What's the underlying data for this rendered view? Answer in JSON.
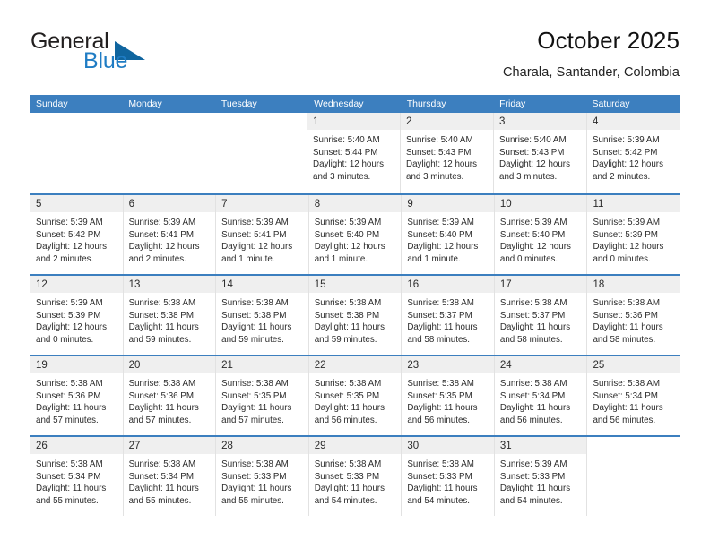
{
  "brand": {
    "name_part1": "General",
    "name_part2": "Blue",
    "color_dark": "#221f1f",
    "color_blue": "#1f7cc4",
    "triangle_color": "#10659f"
  },
  "header": {
    "title": "October 2025",
    "subtitle": "Charala, Santander, Colombia"
  },
  "theme": {
    "header_bar": "#3c7fbf",
    "day_band": "#efefef",
    "cell_divider": "#e2e2e2",
    "text": "#2b2b2b"
  },
  "weekdays": [
    "Sunday",
    "Monday",
    "Tuesday",
    "Wednesday",
    "Thursday",
    "Friday",
    "Saturday"
  ],
  "weeks": [
    [
      {
        "blank": true
      },
      {
        "blank": true
      },
      {
        "blank": true
      },
      {
        "day": "1",
        "lines": [
          "Sunrise: 5:40 AM",
          "Sunset: 5:44 PM",
          "Daylight: 12 hours",
          "and 3 minutes."
        ]
      },
      {
        "day": "2",
        "lines": [
          "Sunrise: 5:40 AM",
          "Sunset: 5:43 PM",
          "Daylight: 12 hours",
          "and 3 minutes."
        ]
      },
      {
        "day": "3",
        "lines": [
          "Sunrise: 5:40 AM",
          "Sunset: 5:43 PM",
          "Daylight: 12 hours",
          "and 3 minutes."
        ]
      },
      {
        "day": "4",
        "lines": [
          "Sunrise: 5:39 AM",
          "Sunset: 5:42 PM",
          "Daylight: 12 hours",
          "and 2 minutes."
        ]
      }
    ],
    [
      {
        "day": "5",
        "lines": [
          "Sunrise: 5:39 AM",
          "Sunset: 5:42 PM",
          "Daylight: 12 hours",
          "and 2 minutes."
        ]
      },
      {
        "day": "6",
        "lines": [
          "Sunrise: 5:39 AM",
          "Sunset: 5:41 PM",
          "Daylight: 12 hours",
          "and 2 minutes."
        ]
      },
      {
        "day": "7",
        "lines": [
          "Sunrise: 5:39 AM",
          "Sunset: 5:41 PM",
          "Daylight: 12 hours",
          "and 1 minute."
        ]
      },
      {
        "day": "8",
        "lines": [
          "Sunrise: 5:39 AM",
          "Sunset: 5:40 PM",
          "Daylight: 12 hours",
          "and 1 minute."
        ]
      },
      {
        "day": "9",
        "lines": [
          "Sunrise: 5:39 AM",
          "Sunset: 5:40 PM",
          "Daylight: 12 hours",
          "and 1 minute."
        ]
      },
      {
        "day": "10",
        "lines": [
          "Sunrise: 5:39 AM",
          "Sunset: 5:40 PM",
          "Daylight: 12 hours",
          "and 0 minutes."
        ]
      },
      {
        "day": "11",
        "lines": [
          "Sunrise: 5:39 AM",
          "Sunset: 5:39 PM",
          "Daylight: 12 hours",
          "and 0 minutes."
        ]
      }
    ],
    [
      {
        "day": "12",
        "lines": [
          "Sunrise: 5:39 AM",
          "Sunset: 5:39 PM",
          "Daylight: 12 hours",
          "and 0 minutes."
        ]
      },
      {
        "day": "13",
        "lines": [
          "Sunrise: 5:38 AM",
          "Sunset: 5:38 PM",
          "Daylight: 11 hours",
          "and 59 minutes."
        ]
      },
      {
        "day": "14",
        "lines": [
          "Sunrise: 5:38 AM",
          "Sunset: 5:38 PM",
          "Daylight: 11 hours",
          "and 59 minutes."
        ]
      },
      {
        "day": "15",
        "lines": [
          "Sunrise: 5:38 AM",
          "Sunset: 5:38 PM",
          "Daylight: 11 hours",
          "and 59 minutes."
        ]
      },
      {
        "day": "16",
        "lines": [
          "Sunrise: 5:38 AM",
          "Sunset: 5:37 PM",
          "Daylight: 11 hours",
          "and 58 minutes."
        ]
      },
      {
        "day": "17",
        "lines": [
          "Sunrise: 5:38 AM",
          "Sunset: 5:37 PM",
          "Daylight: 11 hours",
          "and 58 minutes."
        ]
      },
      {
        "day": "18",
        "lines": [
          "Sunrise: 5:38 AM",
          "Sunset: 5:36 PM",
          "Daylight: 11 hours",
          "and 58 minutes."
        ]
      }
    ],
    [
      {
        "day": "19",
        "lines": [
          "Sunrise: 5:38 AM",
          "Sunset: 5:36 PM",
          "Daylight: 11 hours",
          "and 57 minutes."
        ]
      },
      {
        "day": "20",
        "lines": [
          "Sunrise: 5:38 AM",
          "Sunset: 5:36 PM",
          "Daylight: 11 hours",
          "and 57 minutes."
        ]
      },
      {
        "day": "21",
        "lines": [
          "Sunrise: 5:38 AM",
          "Sunset: 5:35 PM",
          "Daylight: 11 hours",
          "and 57 minutes."
        ]
      },
      {
        "day": "22",
        "lines": [
          "Sunrise: 5:38 AM",
          "Sunset: 5:35 PM",
          "Daylight: 11 hours",
          "and 56 minutes."
        ]
      },
      {
        "day": "23",
        "lines": [
          "Sunrise: 5:38 AM",
          "Sunset: 5:35 PM",
          "Daylight: 11 hours",
          "and 56 minutes."
        ]
      },
      {
        "day": "24",
        "lines": [
          "Sunrise: 5:38 AM",
          "Sunset: 5:34 PM",
          "Daylight: 11 hours",
          "and 56 minutes."
        ]
      },
      {
        "day": "25",
        "lines": [
          "Sunrise: 5:38 AM",
          "Sunset: 5:34 PM",
          "Daylight: 11 hours",
          "and 56 minutes."
        ]
      }
    ],
    [
      {
        "day": "26",
        "lines": [
          "Sunrise: 5:38 AM",
          "Sunset: 5:34 PM",
          "Daylight: 11 hours",
          "and 55 minutes."
        ]
      },
      {
        "day": "27",
        "lines": [
          "Sunrise: 5:38 AM",
          "Sunset: 5:34 PM",
          "Daylight: 11 hours",
          "and 55 minutes."
        ]
      },
      {
        "day": "28",
        "lines": [
          "Sunrise: 5:38 AM",
          "Sunset: 5:33 PM",
          "Daylight: 11 hours",
          "and 55 minutes."
        ]
      },
      {
        "day": "29",
        "lines": [
          "Sunrise: 5:38 AM",
          "Sunset: 5:33 PM",
          "Daylight: 11 hours",
          "and 54 minutes."
        ]
      },
      {
        "day": "30",
        "lines": [
          "Sunrise: 5:38 AM",
          "Sunset: 5:33 PM",
          "Daylight: 11 hours",
          "and 54 minutes."
        ]
      },
      {
        "day": "31",
        "lines": [
          "Sunrise: 5:39 AM",
          "Sunset: 5:33 PM",
          "Daylight: 11 hours",
          "and 54 minutes."
        ]
      },
      {
        "blank": true
      }
    ]
  ]
}
